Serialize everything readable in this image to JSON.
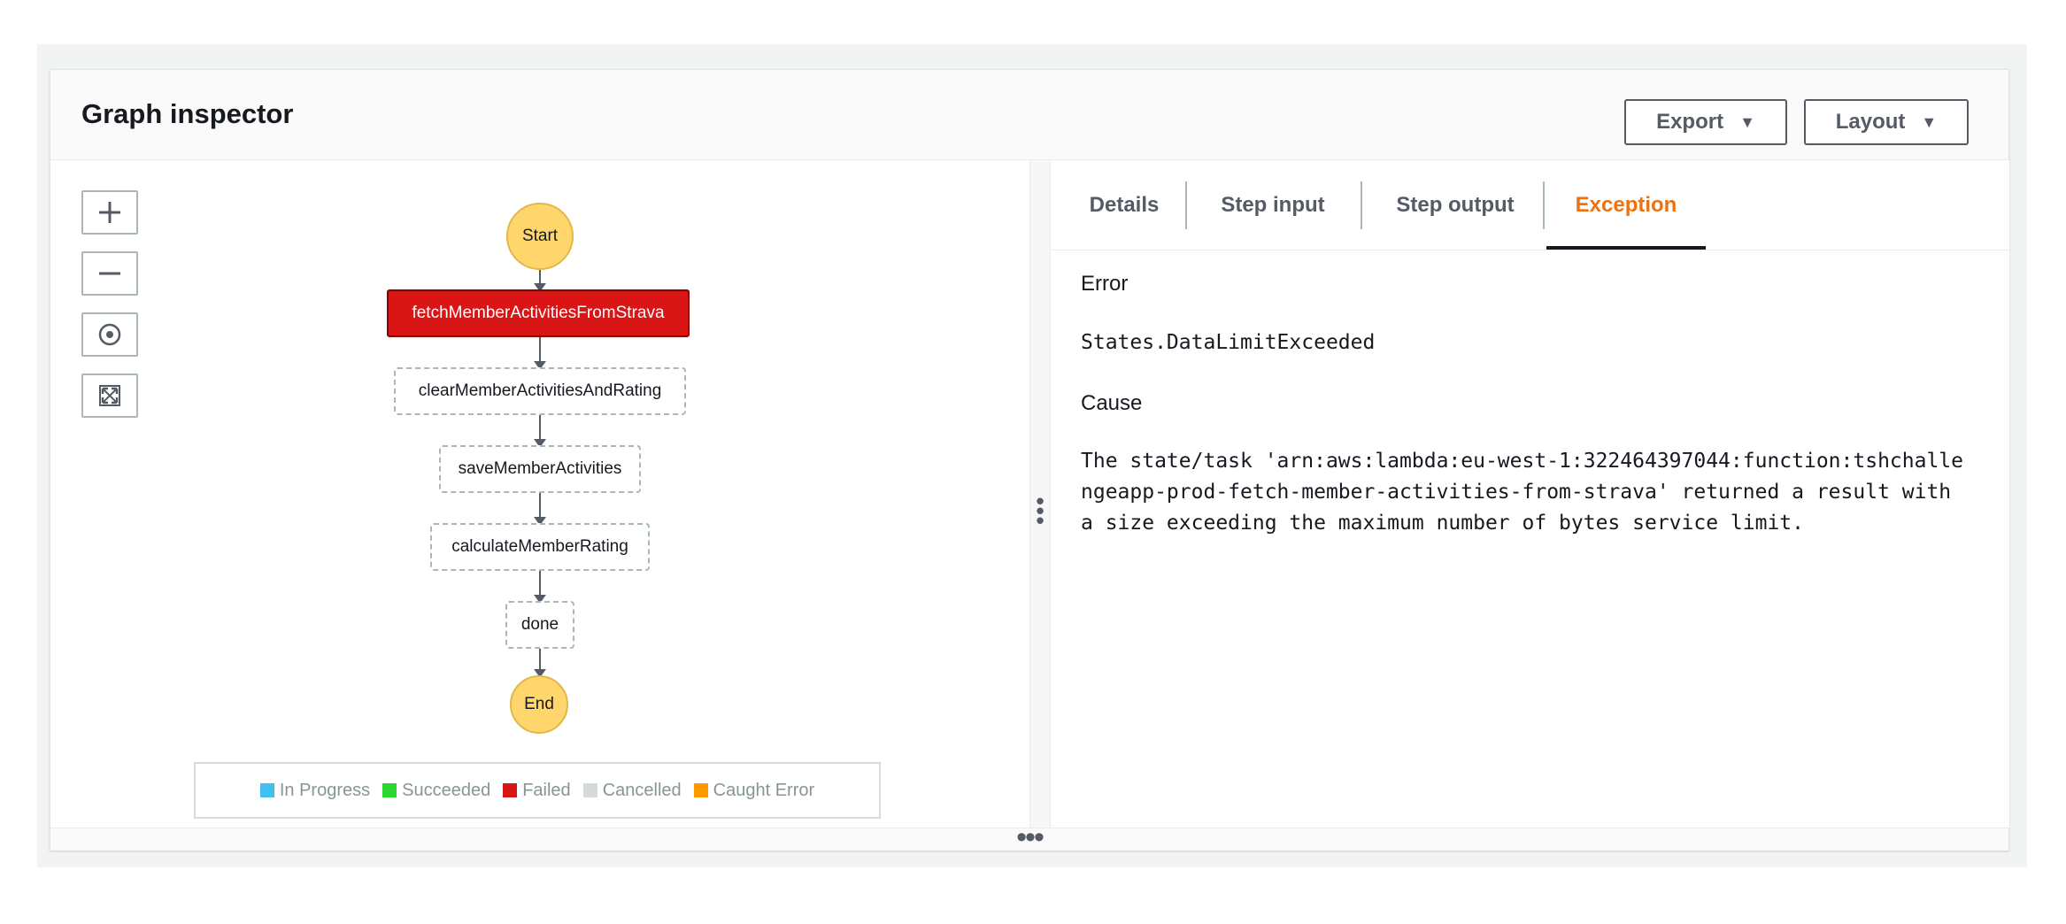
{
  "panel": {
    "title": "Graph inspector",
    "export_label": "Export",
    "layout_label": "Layout",
    "caret": "▼"
  },
  "zoom_controls": {
    "zoom_in": "+",
    "zoom_out": "—",
    "center": "center-icon",
    "fit": "fit-icon"
  },
  "graph": {
    "nodes": [
      {
        "id": "start",
        "label": "Start",
        "type": "start"
      },
      {
        "id": "fetch",
        "label": "fetchMemberActivitiesFromStrava",
        "type": "task",
        "status": "Failed"
      },
      {
        "id": "clear",
        "label": "clearMemberActivitiesAndRating",
        "type": "task",
        "status": "Cancelled"
      },
      {
        "id": "save",
        "label": "saveMemberActivities",
        "type": "task",
        "status": "Cancelled"
      },
      {
        "id": "calc",
        "label": "calculateMemberRating",
        "type": "task",
        "status": "Cancelled"
      },
      {
        "id": "done",
        "label": "done",
        "type": "task",
        "status": "Cancelled"
      },
      {
        "id": "end",
        "label": "End",
        "type": "end"
      }
    ]
  },
  "legend": [
    {
      "label": "In Progress",
      "color": "#3ec1ee"
    },
    {
      "label": "Succeeded",
      "color": "#2bd62e"
    },
    {
      "label": "Failed",
      "color": "#d91515"
    },
    {
      "label": "Cancelled",
      "color": "#d5dbdb"
    },
    {
      "label": "Caught Error",
      "color": "#ff9900"
    }
  ],
  "tabs": [
    {
      "label": "Details"
    },
    {
      "label": "Step input"
    },
    {
      "label": "Step output"
    },
    {
      "label": "Exception",
      "active": true
    }
  ],
  "exception": {
    "error_label": "Error",
    "error_value": "States.DataLimitExceeded",
    "cause_label": "Cause",
    "cause_value": "The state/task 'arn:aws:lambda:eu-west-1:322464397044:function:tshchallengeapp-prod-fetch-member-activities-from-strava' returned a result with a size exceeding the maximum number of bytes service limit."
  },
  "colors": {
    "accent": "#ec7211",
    "failed": "#d91515",
    "start_end": "#ffd66b"
  }
}
